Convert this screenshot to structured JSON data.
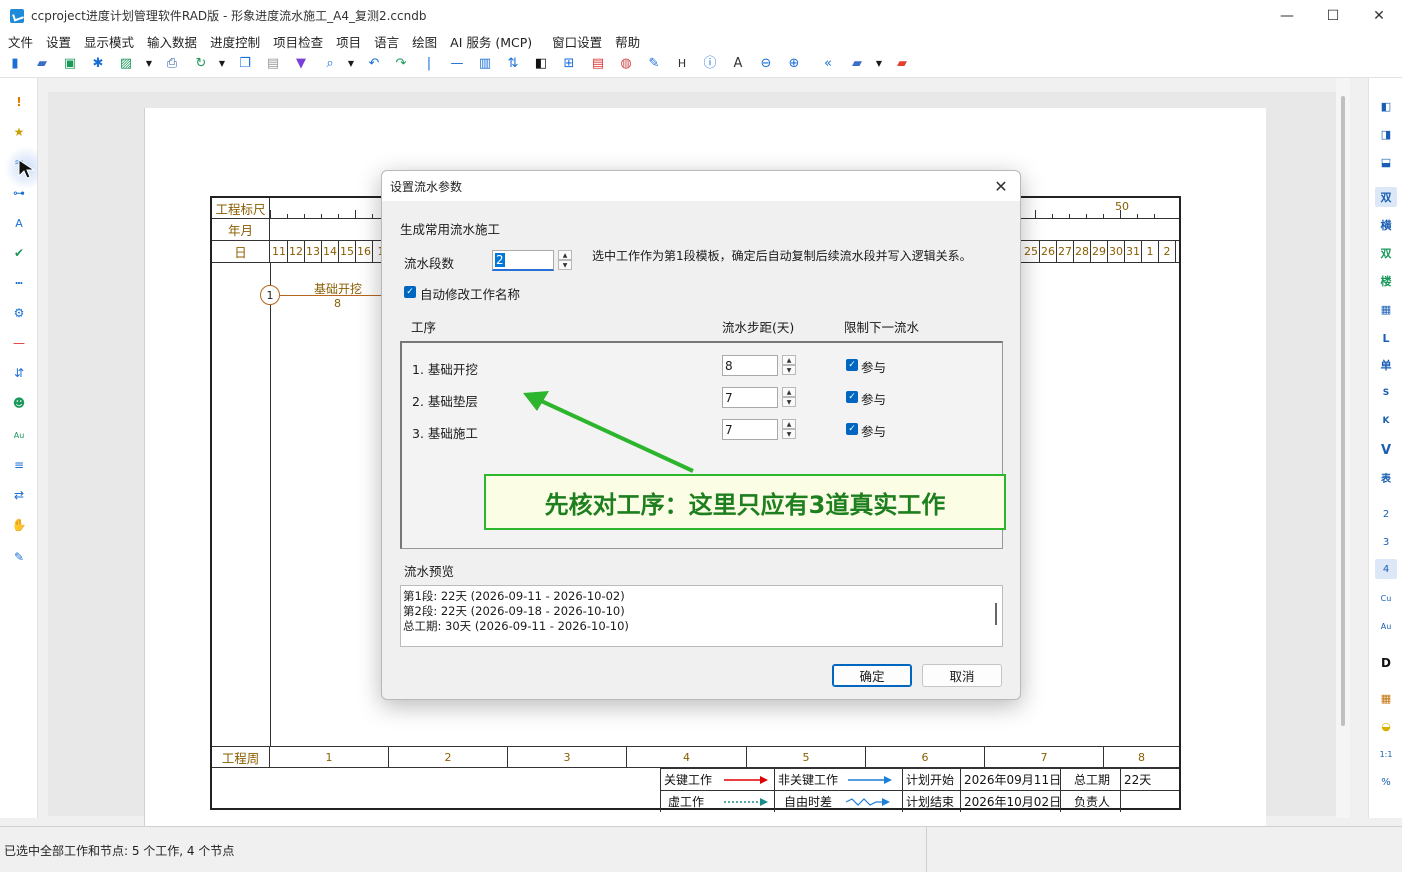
{
  "window": {
    "title": "ccproject进度计划管理软件RAD版 - 形象进度流水施工_A4_复测2.ccndb",
    "minimize": "—",
    "maximize": "☐",
    "close": "✕"
  },
  "menu": [
    "文件",
    "设置",
    "显示模式",
    "输入数据",
    "进度控制",
    "项目检查",
    "项目",
    "语言",
    "绘图",
    "AI 服务 (MCP)",
    "窗口设置",
    "帮助"
  ],
  "right_toolbar": [
    "双",
    "横",
    "双",
    "楼",
    "▦",
    "L",
    "单",
    "S",
    "K",
    "V",
    "表",
    "2",
    "3",
    "4",
    "Cu",
    "Au",
    "D",
    "1:1",
    "%"
  ],
  "gantt": {
    "row_labels": [
      "工程标尺",
      "年月",
      "日",
      "工程周"
    ],
    "ruler_mark": "50",
    "days_left": [
      "11",
      "12",
      "13",
      "14",
      "15",
      "16",
      "1"
    ],
    "days_right": [
      "25",
      "26",
      "27",
      "28",
      "29",
      "30",
      "31",
      "1",
      "2"
    ],
    "weeks": [
      "1",
      "2",
      "3",
      "4",
      "5",
      "6",
      "7",
      "8"
    ],
    "node_label": "1",
    "task_name": "基础开挖",
    "task_duration": "8",
    "legend": {
      "critical": "关键工作",
      "non_critical": "非关键工作",
      "plan_start_label": "计划开始",
      "plan_start": "2026年09月11日",
      "total_duration_label": "总工期",
      "total_duration": "22天",
      "virtual": "虚工作",
      "free_float": "自由时差",
      "plan_end_label": "计划结束",
      "plan_end": "2026年10月02日",
      "owner_label": "负责人"
    }
  },
  "dialog": {
    "title": "设置流水参数",
    "section": "生成常用流水施工",
    "segments_label": "流水段数",
    "segments_value": "2",
    "hint": "选中工作作为第1段模板，确定后自动复制后续流水段并写入逻辑关系。",
    "auto_rename": "自动修改工作名称",
    "columns": [
      "工序",
      "流水步距(天)",
      "限制下一流水"
    ],
    "rows": [
      {
        "name": "1. 基础开挖",
        "step": "8",
        "check": "参与"
      },
      {
        "name": "2. 基础垫层",
        "step": "7",
        "check": "参与"
      },
      {
        "name": "3. 基础施工",
        "step": "7",
        "check": "参与"
      }
    ],
    "preview_label": "流水预览",
    "preview": [
      "第1段: 22天 (2026-09-11 - 2026-10-02)",
      "第2段: 22天 (2026-09-18 - 2026-10-10)",
      "总工期: 30天 (2026-09-11 - 2026-10-10)"
    ],
    "ok": "确定",
    "cancel": "取消"
  },
  "annotation": "先核对工序：这里只应有3道真实工作",
  "status": "已选中全部工作和节点: 5 个工作, 4 个节点",
  "colors": {
    "accent": "#0067c0",
    "annotation_green": "#2db52d",
    "gantt_text": "#8a5e00",
    "critical_red": "#e00000",
    "noncritical_blue": "#1e7fd6"
  }
}
